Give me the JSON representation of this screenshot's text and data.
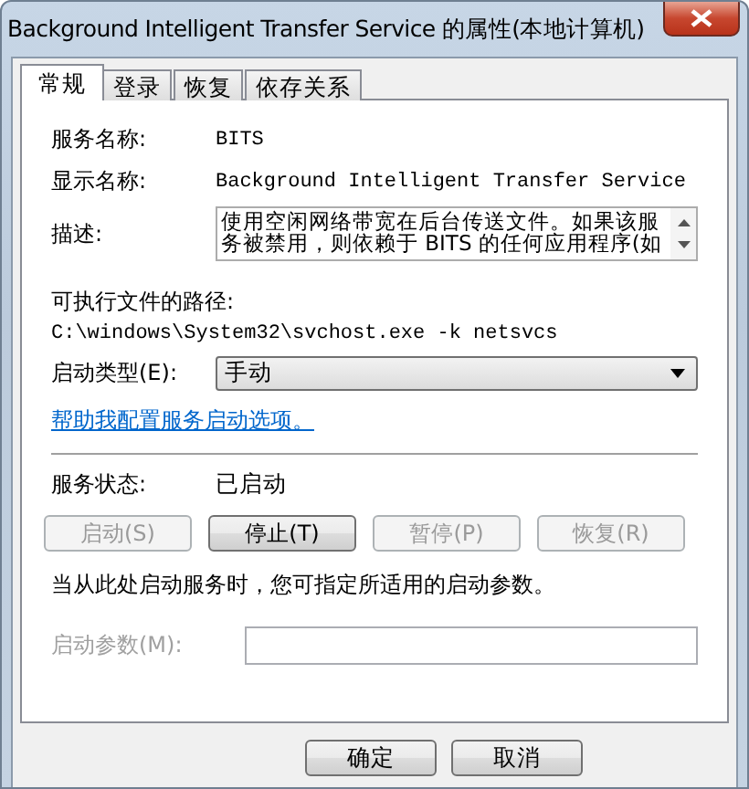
{
  "window": {
    "title": "Background Intelligent Transfer Service 的属性(本地计算机)"
  },
  "tabs": [
    {
      "label": "常规",
      "selected": true
    },
    {
      "label": "登录",
      "selected": false
    },
    {
      "label": "恢复",
      "selected": false
    },
    {
      "label": "依存关系",
      "selected": false
    }
  ],
  "general": {
    "service_name": {
      "label": "服务名称:",
      "value": "BITS"
    },
    "display_name": {
      "label": "显示名称:",
      "value": "Background Intelligent Transfer Service"
    },
    "description": {
      "label": "描述:",
      "value": "使用空闲网络带宽在后台传送文件。如果该服务被禁用，则依赖于 BITS 的任何应用程序(如"
    },
    "executable_path": {
      "label": "可执行文件的路径:",
      "value": "C:\\windows\\System32\\svchost.exe -k netsvcs"
    },
    "startup_type": {
      "label": "启动类型(E):",
      "value": "手动"
    },
    "help_link": "帮助我配置服务启动选项。",
    "service_status": {
      "label": "服务状态:",
      "value": "已启动"
    },
    "service_buttons": [
      {
        "label": "启动(S)",
        "disabled": true
      },
      {
        "label": "停止(T)",
        "disabled": false
      },
      {
        "label": "暂停(P)",
        "disabled": true
      },
      {
        "label": "恢复(R)",
        "disabled": true
      }
    ],
    "hint": "当从此处启动服务时，您可指定所适用的启动参数。",
    "start_parameters": {
      "label": "启动参数(M):",
      "disabled": true
    }
  },
  "dialog_buttons": [
    "确定",
    "取消"
  ]
}
